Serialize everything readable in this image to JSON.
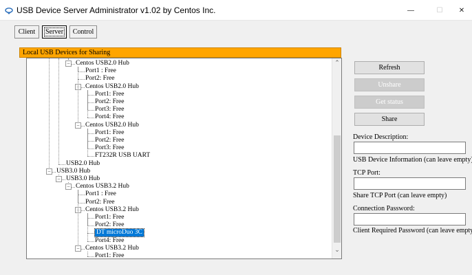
{
  "window": {
    "title": "USB Device Server Administrator v1.02 by Centos Inc.",
    "minimize": "—",
    "maximize": "☐",
    "close": "✕"
  },
  "tabs": [
    {
      "label": "Client",
      "selected": false
    },
    {
      "label": "Server",
      "selected": true
    },
    {
      "label": "Control",
      "selected": false
    }
  ],
  "panel": {
    "header": "Local USB Devices for Sharing"
  },
  "tree": [
    {
      "label": "Centos USB2.0 Hub",
      "level": 3,
      "expander": "−"
    },
    {
      "label": "Port1 : Free",
      "level": 4
    },
    {
      "label": "Port2: Free",
      "level": 4
    },
    {
      "label": "Centos USB2.0 Hub",
      "level": 4,
      "expander": "−"
    },
    {
      "label": "Port1: Free",
      "level": 5
    },
    {
      "label": "Port2: Free",
      "level": 5
    },
    {
      "label": "Port3: Free",
      "level": 5
    },
    {
      "label": "Port4: Free",
      "level": 5
    },
    {
      "label": "Centos USB2.0 Hub",
      "level": 4,
      "expander": "−"
    },
    {
      "label": "Port1: Free",
      "level": 5
    },
    {
      "label": "Port2: Free",
      "level": 5
    },
    {
      "label": "Port3: Free",
      "level": 5
    },
    {
      "label": "FT232R USB UART",
      "level": 5
    },
    {
      "label": "USB2.0 Hub",
      "level": 2
    },
    {
      "label": "USB3.0 Hub",
      "level": 1,
      "expander": "−"
    },
    {
      "label": "USB3.0 Hub",
      "level": 2,
      "expander": "−"
    },
    {
      "label": "Centos USB3.2 Hub",
      "level": 3,
      "expander": "−"
    },
    {
      "label": "Port1 : Free",
      "level": 4
    },
    {
      "label": "Port2: Free",
      "level": 4
    },
    {
      "label": "Centos USB3.2 Hub",
      "level": 4,
      "expander": "−"
    },
    {
      "label": "Port1: Free",
      "level": 5
    },
    {
      "label": "Port2: Free",
      "level": 5
    },
    {
      "label": "DT microDuo 3C",
      "level": 5,
      "selected": true
    },
    {
      "label": "Port4: Free",
      "level": 5
    },
    {
      "label": "Centos USB3.2 Hub",
      "level": 4,
      "expander": "−"
    },
    {
      "label": "Port1: Free",
      "level": 5
    }
  ],
  "scrollbar": {
    "up": "⌃",
    "down": "⌄"
  },
  "sidebar": {
    "refresh": "Refresh",
    "unshare": "Unshare",
    "get_status": "Get status",
    "share": "Share",
    "device_description_label": "Device Description:",
    "device_description_value": "",
    "device_description_hint": "USB Device Information (can leave empty)",
    "tcp_port_label": "TCP Port:",
    "tcp_port_value": "",
    "tcp_port_hint": "Share TCP Port (can leave empty)",
    "password_label": "Connection Password:",
    "password_value": "",
    "password_hint": "Client Required Password  (can leave empty)"
  }
}
